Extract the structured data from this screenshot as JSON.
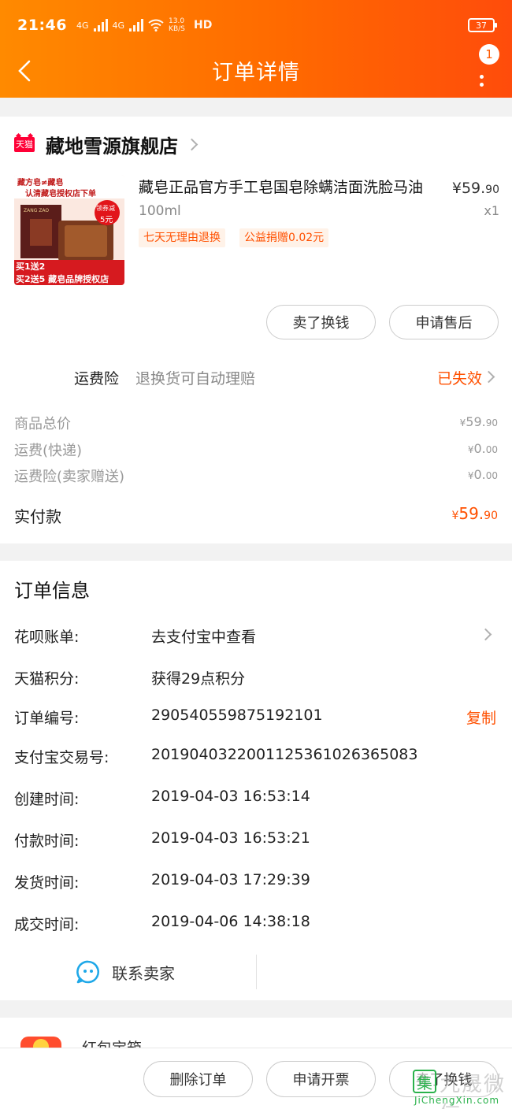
{
  "status_bar": {
    "time": "21:46",
    "net_a": "4G",
    "net_b": "4G",
    "speed": "13.0 KB/S",
    "hd": "HD",
    "battery": "37"
  },
  "nav": {
    "title": "订单详情",
    "message_badge": "1"
  },
  "shop": {
    "logo_text": "天猫",
    "name": "藏地雪源旗舰店"
  },
  "product": {
    "title": "藏皂正品官方手工皂国皂除螨洁面洗脸马油",
    "price_main": "¥59.",
    "price_decimal": "90",
    "spec": "100ml",
    "qty": "x1",
    "tags": [
      "七天无理由退换",
      "公益捐赠0.02元"
    ],
    "thumb": {
      "top_line1": "藏方皂≠藏皂",
      "top_line2": "认清藏皂授权店下单",
      "coupon_line1": "领券减",
      "coupon_line2": "5元",
      "box_label": "ZANG ZAO",
      "bottom_line1": "买1送2",
      "bottom_line2": "买2送5 藏皂品牌授权店"
    }
  },
  "actions": {
    "sell": "卖了换钱",
    "after_sale": "申请售后"
  },
  "insurance": {
    "label": "运费险",
    "desc": "退换货可自动理赔",
    "status": "已失效"
  },
  "fees": [
    {
      "label": "商品总价",
      "yen": "¥",
      "main": "59.",
      "dec": "90"
    },
    {
      "label": "运费(快递)",
      "yen": "¥",
      "main": "0.",
      "dec": "00"
    },
    {
      "label": "运费险(卖家赠送)",
      "yen": "¥",
      "main": "0.",
      "dec": "00"
    }
  ],
  "paid": {
    "label": "实付款",
    "yen": "¥",
    "main": "59.",
    "dec": "90"
  },
  "order_info": {
    "title": "订单信息",
    "rows": [
      {
        "label": "花呗账单:",
        "value": "去支付宝中查看"
      },
      {
        "label": "天猫积分:",
        "value": "获得29点积分"
      },
      {
        "label": "订单编号:",
        "value": "290540559875192101"
      },
      {
        "label": "支付宝交易号:",
        "value": "2019040322001125361026365083"
      },
      {
        "label": "创建时间:",
        "value": "2019-04-03 16:53:14"
      },
      {
        "label": "付款时间:",
        "value": "2019-04-03 16:53:21"
      },
      {
        "label": "发货时间:",
        "value": "2019-04-03 17:29:39"
      },
      {
        "label": "成交时间:",
        "value": "2019-04-06 14:38:18"
      }
    ],
    "copy": "复制",
    "contact": "联系卖家"
  },
  "peek": {
    "text": "红包宝箱"
  },
  "bottom": {
    "delete": "删除订单",
    "invoice": "申请开票",
    "sell": "卖了换钱"
  },
  "watermark": {
    "cn": "九晟微信",
    "en": "JiChengXin.com",
    "logo": "集"
  },
  "colors": {
    "accent": "#ff5000",
    "header_start": "#ff8a00",
    "header_end": "#ff4c0b",
    "tmall_red": "#ff0036"
  }
}
